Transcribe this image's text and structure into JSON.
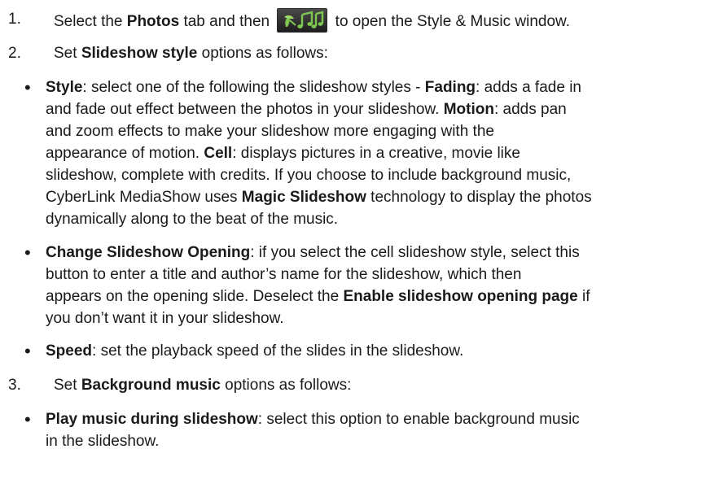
{
  "steps": [
    {
      "number": "1.",
      "before_bold": "Select the ",
      "bold": "Photos",
      "mid": " tab and then ",
      "icon": "style-music-icon",
      "after": " to open the Style & Music window."
    },
    {
      "number": "2.",
      "before_bold": "Set ",
      "bold": "Slideshow style",
      "after": " options as follows:"
    },
    {
      "number": "3.",
      "before_bold": "Set ",
      "bold": "Background music",
      "after": " options as follows:"
    }
  ],
  "bullets": {
    "style": {
      "term": "Style",
      "t1": ": select one of the following the slideshow styles - ",
      "b1": "Fading",
      "t2": ": adds a fade in",
      "t3": "and fade out effect between the photos in your slideshow. ",
      "b2": "Motion",
      "t4": ": adds pan",
      "t5": "and zoom effects to make your slideshow more engaging with the",
      "t6": "appearance of motion. ",
      "b3": "Cell",
      "t7": ": displays pictures in a creative, movie like",
      "t8": "slideshow, complete with credits. If you choose to include background music,",
      "t9": "CyberLink MediaShow uses ",
      "b4": "Magic Slideshow",
      "t10": " technology to display the photos",
      "t11": "dynamically along to the beat of the music."
    },
    "opening": {
      "term": "Change Slideshow Opening",
      "t1": ": if you select the cell slideshow style, select this",
      "t2": "button to enter a title and author’s name for the slideshow, which then",
      "t3": "appears on the opening slide. Deselect the ",
      "b1": "Enable slideshow opening page",
      "t4": " if",
      "t5": "you don’t want it in your slideshow."
    },
    "speed": {
      "term": "Speed",
      "t1": ": set the playback speed of the slides in the slideshow."
    },
    "music": {
      "term": "Play music during slideshow",
      "t1": ": select this option to enable background music",
      "t2": "in the slideshow."
    }
  },
  "bullet_glyph": "•",
  "colors": {
    "icon_green": "#7ec850",
    "icon_bg": "#2a2a2a"
  }
}
